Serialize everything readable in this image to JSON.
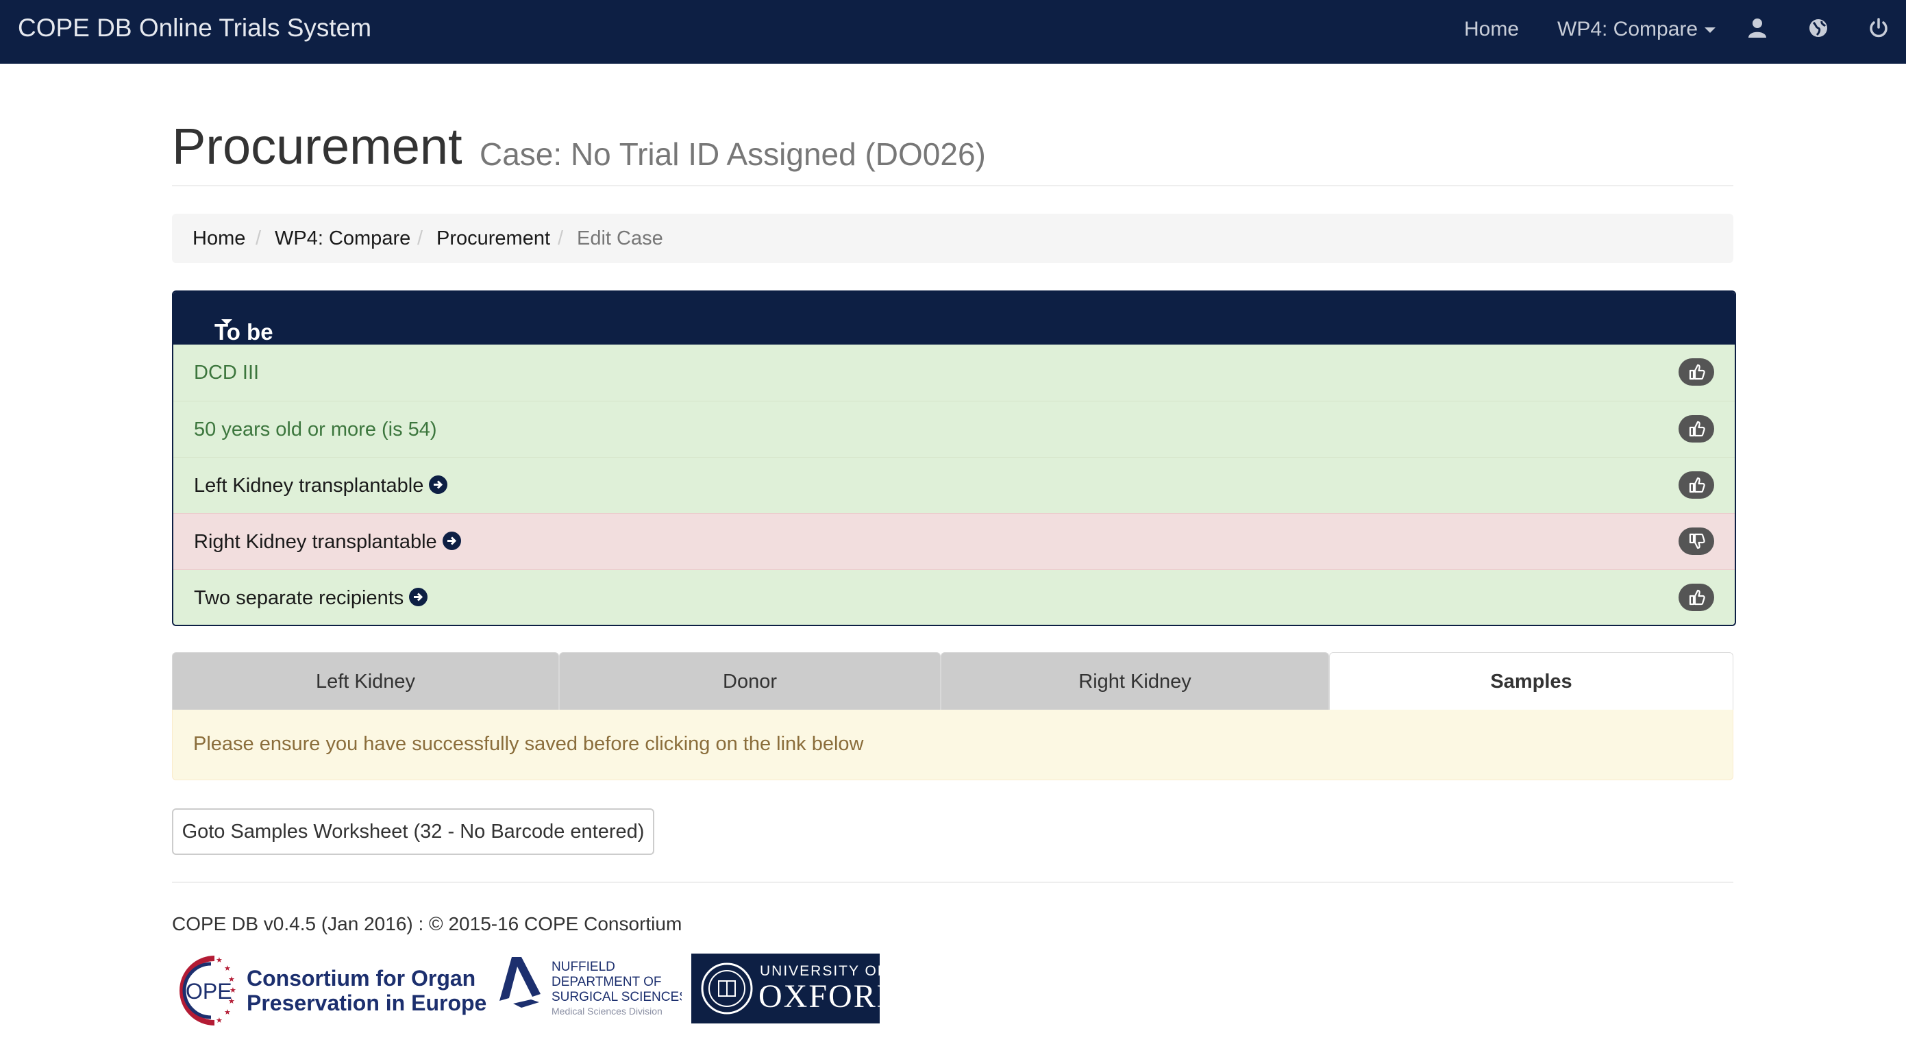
{
  "navbar": {
    "brand": "COPE DB Online Trials System",
    "home": "Home",
    "compare": "WP4: Compare",
    "icons": [
      "user-icon",
      "globe-icon",
      "power-icon"
    ],
    "background": "#0d1f44"
  },
  "header": {
    "title": "Procurement",
    "subtitle": "Case: No Trial ID Assigned (DO026)"
  },
  "breadcrumb": {
    "items": [
      "Home",
      "WP4: Compare",
      "Procurement"
    ],
    "active": "Edit Case"
  },
  "eligibility": {
    "heading": "To be eligible for this trial you must satisfy the following conditions...",
    "rows": [
      {
        "text": "DCD III",
        "status": "pass",
        "link": false
      },
      {
        "text": "50 years old or more (is 54)",
        "status": "pass",
        "link": false
      },
      {
        "text": "Left Kidney transplantable",
        "status": "pass",
        "link": true
      },
      {
        "text": "Right Kidney transplantable",
        "status": "fail",
        "link": true
      },
      {
        "text": "Two separate recipients",
        "status": "pass",
        "link": true
      }
    ],
    "colors": {
      "pass": "#dff0d8",
      "fail": "#f2dede",
      "pass_text": "#3c763d"
    }
  },
  "tabs": [
    {
      "label": "Left Kidney",
      "active": false
    },
    {
      "label": "Donor",
      "active": false
    },
    {
      "label": "Right Kidney",
      "active": false
    },
    {
      "label": "Samples",
      "active": true
    }
  ],
  "alert": {
    "text": "Please ensure you have successfully saved before clicking on the link below"
  },
  "button": {
    "label": "Goto Samples Worksheet (32 - No Barcode entered)"
  },
  "footer": {
    "text": "COPE DB v0.4.5 (Jan 2016) : © 2015-16 COPE Consortium",
    "logos": {
      "cope": [
        "OPE",
        "Consortium for Organ",
        "Preservation in Europe"
      ],
      "nds": [
        "NUFFIELD",
        "DEPARTMENT OF",
        "SURGICAL SCIENCES",
        "Medical Sciences Division"
      ],
      "oxford": [
        "UNIVERSITY OF",
        "OXFORD"
      ]
    }
  }
}
